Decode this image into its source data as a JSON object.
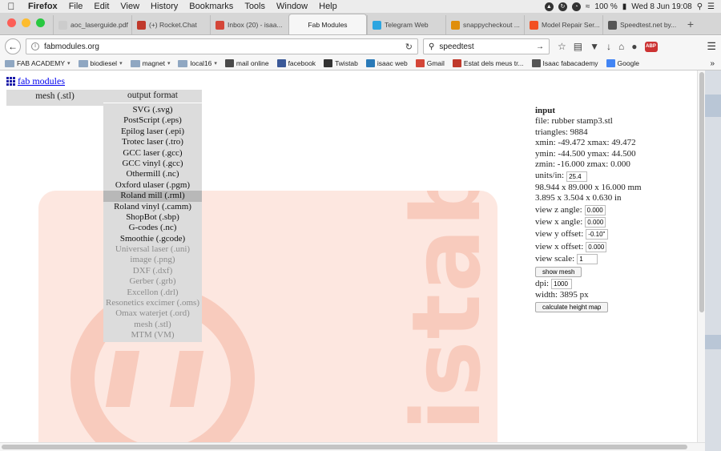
{
  "menubar": {
    "app": "Firefox",
    "items": [
      "File",
      "Edit",
      "View",
      "History",
      "Bookmarks",
      "Tools",
      "Window",
      "Help"
    ],
    "battery": "100 %",
    "clock": "Wed 8 Jun  19:08"
  },
  "tabs": [
    {
      "label": "aoc_laserguide.pdf",
      "color": "#cccccc"
    },
    {
      "label": "(+) Rocket.Chat",
      "color": "#c0392b"
    },
    {
      "label": "Inbox (20) - isaa...",
      "color": "#d44638"
    },
    {
      "label": "Fab Modules",
      "color": "",
      "active": true
    },
    {
      "label": "Telegram Web",
      "color": "#2ca5e0"
    },
    {
      "label": "snappycheckout ...",
      "color": "#e08e0b"
    },
    {
      "label": "Model Repair Ser...",
      "color": "#f25022"
    },
    {
      "label": "Speedtest.net by...",
      "color": "#555555"
    }
  ],
  "nav": {
    "url": "fabmodules.org",
    "search": "speedtest"
  },
  "bookmarks": [
    {
      "label": "FAB ACADEMY",
      "type": "folder"
    },
    {
      "label": "biodiesel",
      "type": "folder"
    },
    {
      "label": "magnet",
      "type": "folder"
    },
    {
      "label": "local16",
      "type": "folder"
    },
    {
      "label": "mail online",
      "type": "link",
      "color": "#4a4a4a"
    },
    {
      "label": "facebook",
      "type": "link",
      "color": "#3b5998"
    },
    {
      "label": "Twistab",
      "type": "link",
      "color": "#333333"
    },
    {
      "label": "isaac web",
      "type": "link",
      "color": "#2a7ab8"
    },
    {
      "label": "Gmail",
      "type": "link",
      "color": "#d44638"
    },
    {
      "label": "Estat dels meus tr...",
      "type": "link",
      "color": "#c0392b"
    },
    {
      "label": "Isaac fabacademy",
      "type": "link",
      "color": "#555555"
    },
    {
      "label": "Google",
      "type": "link",
      "color": "#4285f4"
    }
  ],
  "page": {
    "logo_text": "fab modules",
    "input_format": "mesh (.stl)",
    "output_header": "output format",
    "formats": [
      {
        "label": "SVG (.svg)",
        "state": "normal"
      },
      {
        "label": "PostScript (.eps)",
        "state": "normal"
      },
      {
        "label": "Epilog laser (.epi)",
        "state": "normal"
      },
      {
        "label": "Trotec laser (.tro)",
        "state": "normal"
      },
      {
        "label": "GCC laser (.gcc)",
        "state": "normal"
      },
      {
        "label": "GCC vinyl (.gcc)",
        "state": "normal"
      },
      {
        "label": "Othermill (.nc)",
        "state": "normal"
      },
      {
        "label": "Oxford ulaser (.pgm)",
        "state": "normal"
      },
      {
        "label": "Roland mill (.rml)",
        "state": "selected"
      },
      {
        "label": "Roland vinyl (.camm)",
        "state": "normal"
      },
      {
        "label": "ShopBot (.sbp)",
        "state": "normal"
      },
      {
        "label": "G-codes (.nc)",
        "state": "normal"
      },
      {
        "label": "Smoothie (.gcode)",
        "state": "normal"
      },
      {
        "label": "Universal laser (.uni)",
        "state": "disabled"
      },
      {
        "label": "image (.png)",
        "state": "disabled"
      },
      {
        "label": "DXF (.dxf)",
        "state": "disabled"
      },
      {
        "label": "Gerber (.grb)",
        "state": "disabled"
      },
      {
        "label": "Excellon (.drl)",
        "state": "disabled"
      },
      {
        "label": "Resonetics excimer (.oms)",
        "state": "disabled"
      },
      {
        "label": "Omax waterjet (.ord)",
        "state": "disabled"
      },
      {
        "label": "mesh (.stl)",
        "state": "disabled"
      },
      {
        "label": "MTM (VM)",
        "state": "disabled"
      }
    ],
    "background_text": "istab"
  },
  "input": {
    "heading": "input",
    "file": "file: rubber stamp3.stl",
    "triangles": "triangles: 9884",
    "xrange": "xmin: -49.472 xmax: 49.472",
    "yrange": "ymin: -44.500 ymax: 44.500",
    "zrange": "zmin: -16.000 zmax: 0.000",
    "units_label": "units/in:",
    "units_value": "25.4",
    "size_mm": "98.944 x 89.000 x 16.000 mm",
    "size_in": "3.895 x 3.504 x 0.630 in",
    "view_z_angle_label": "view z angle:",
    "view_z_angle": "0.000",
    "view_x_angle_label": "view x angle:",
    "view_x_angle": "0.000",
    "view_y_offset_label": "view y offset:",
    "view_y_offset": "-0.10\"",
    "view_x_offset_label": "view x offset:",
    "view_x_offset": "0.000",
    "view_scale_label": "view scale:",
    "view_scale": "1",
    "show_mesh": "show mesh",
    "dpi_label": "dpi:",
    "dpi": "1000",
    "width": "width: 3895 px",
    "calc_button": "calculate height map"
  }
}
